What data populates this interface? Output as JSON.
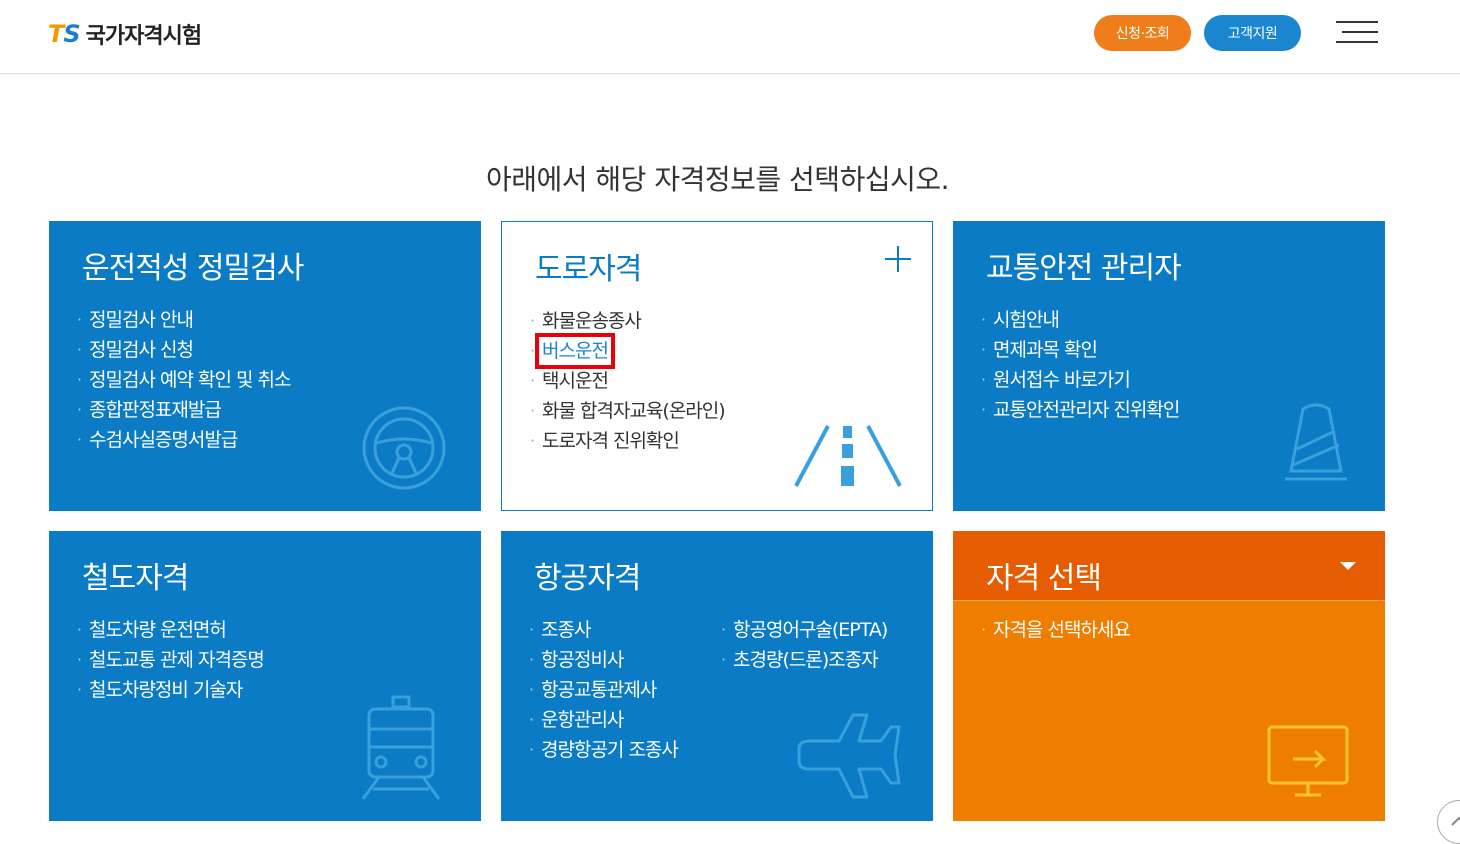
{
  "header": {
    "logo_mark_t": "T",
    "logo_mark_s": "S",
    "logo_text": "국가자격시험",
    "apply_button": "신청·조회",
    "support_button": "고객지원"
  },
  "headline": "아래에서 해당 자격정보를 선택하십시오.",
  "cards": {
    "aptitude": {
      "title": "운전적성 정밀검사",
      "items": [
        "정밀검사 안내",
        "정밀검사 신청",
        "정밀검사 예약 확인 및 취소",
        "종합판정표재발급",
        "수검사실증명서발급"
      ],
      "icon": "steering-wheel-icon"
    },
    "road": {
      "title": "도로자격",
      "items": [
        "화물운송종사",
        "버스운전",
        "택시운전",
        "화물 합격자교육(온라인)",
        "도로자격 진위확인"
      ],
      "icon": "road-icon"
    },
    "safety": {
      "title": "교통안전 관리자",
      "items": [
        "시험안내",
        "면제과목 확인",
        "원서접수 바로가기",
        "교통안전관리자 진위확인"
      ],
      "icon": "traffic-cone-icon"
    },
    "rail": {
      "title": "철도자격",
      "items": [
        "철도차량 운전면허",
        "철도교통 관제 자격증명",
        "철도차량정비 기술자"
      ],
      "icon": "train-icon"
    },
    "aviation": {
      "title": "항공자격",
      "items_col1": [
        "조종사",
        "항공정비사",
        "항공교통관제사",
        "운항관리사",
        "경량항공기 조종사"
      ],
      "items_col2": [
        "항공영어구술(EPTA)",
        "초경량(드론)조종자"
      ],
      "icon": "airplane-icon"
    },
    "select": {
      "title": "자격 선택",
      "items": [
        "자격을 선택하세요"
      ],
      "icon": "monitor-icon"
    }
  },
  "colors": {
    "blue": "#0a7bc4",
    "orange": "#ef7d00",
    "dark_orange": "#e65c00",
    "highlight_red": "#e8000b"
  }
}
